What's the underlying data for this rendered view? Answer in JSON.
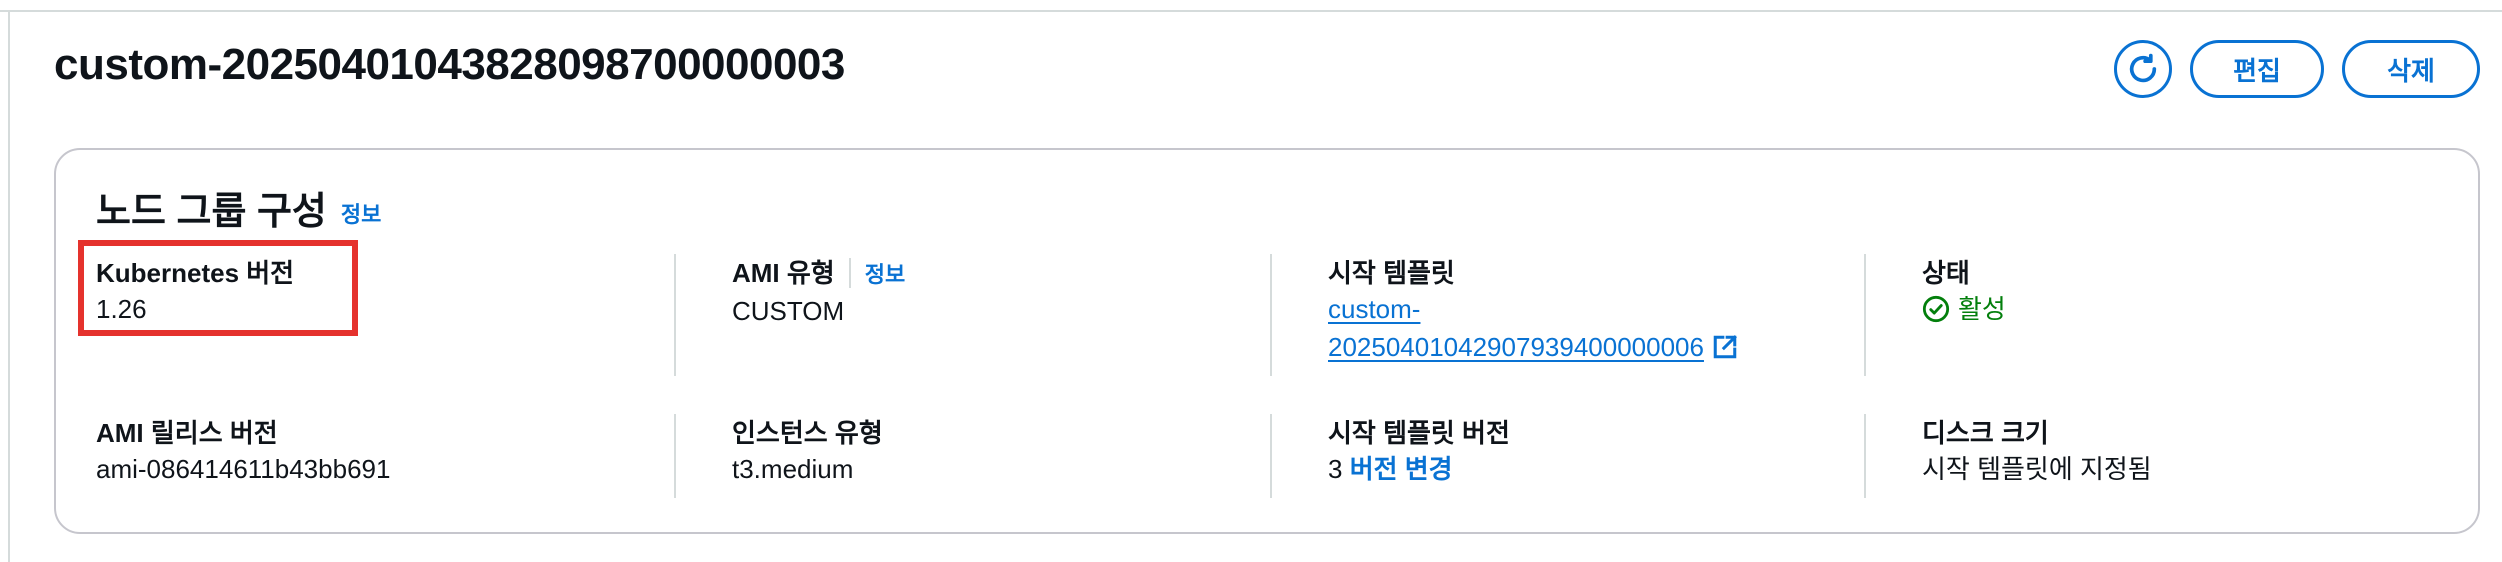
{
  "page": {
    "title": "custom-20250401043828098700000003"
  },
  "actions": {
    "refresh_icon": "refresh-icon",
    "edit_label": "편집",
    "delete_label": "삭제"
  },
  "card": {
    "title": "노드 그룹 구성",
    "info_label": "정보",
    "fields": {
      "k8s_version": {
        "label": "Kubernetes 버전",
        "value": "1.26"
      },
      "ami_type": {
        "label": "AMI 유형",
        "info": "정보",
        "value": "CUSTOM"
      },
      "launch_template": {
        "label": "시작 템플릿",
        "value_line1": "custom-",
        "value_line2": "20250401042907939400000006",
        "icon": "external-link-icon"
      },
      "status": {
        "label": "상태",
        "value": "활성",
        "icon": "check-circle-icon",
        "color": "#037f0c"
      },
      "ami_release": {
        "label": "AMI 릴리스 버전",
        "value": "ami-086414611b43bb691"
      },
      "instance_type": {
        "label": "인스턴스 유형",
        "value": "t3.medium"
      },
      "template_version": {
        "label": "시작 템플릿 버전",
        "value": "3",
        "link": "버전 변경"
      },
      "disk_size": {
        "label": "디스크 크기",
        "value": "시작 템플릿에 지정됨"
      }
    }
  },
  "colors": {
    "accent": "#0972d3",
    "success": "#037f0c",
    "highlight": "#e5322d"
  }
}
